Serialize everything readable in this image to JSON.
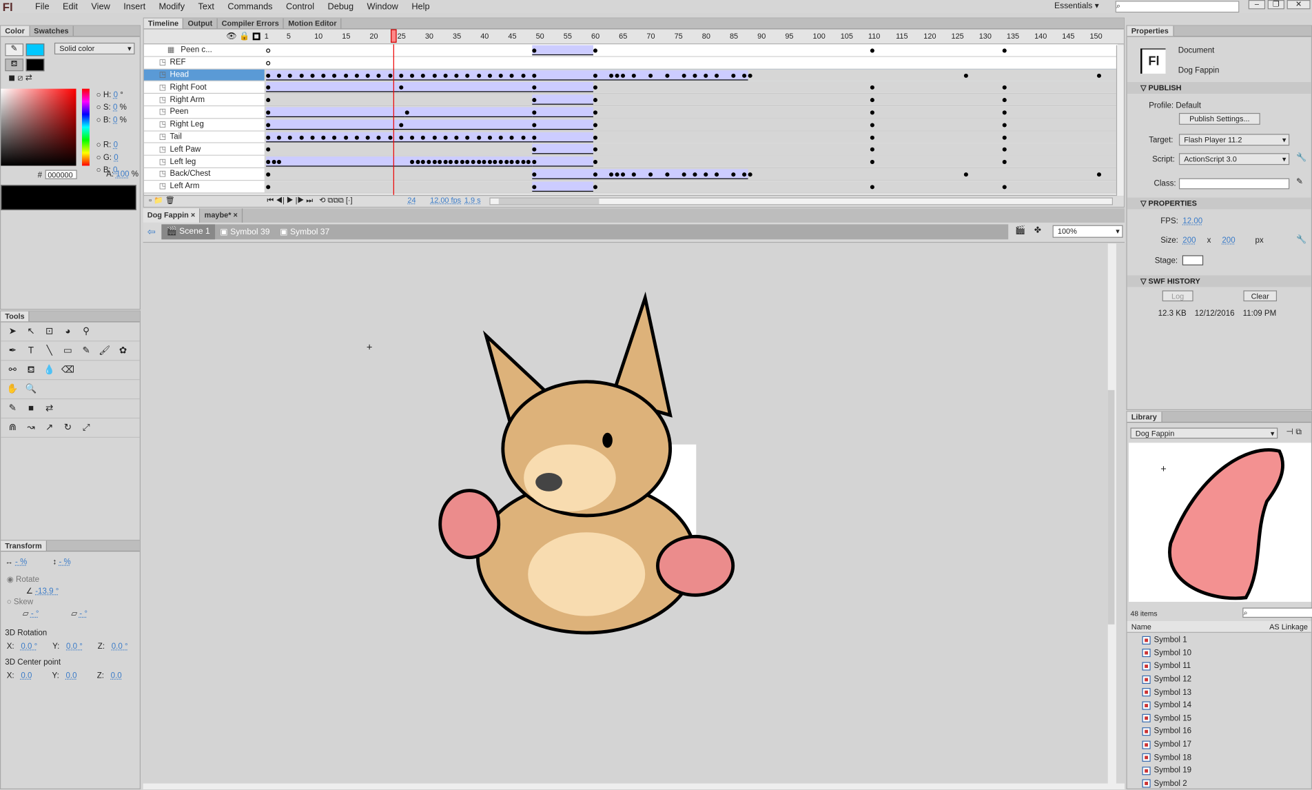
{
  "menu": {
    "logo": "Fl",
    "items": [
      "File",
      "Edit",
      "View",
      "Insert",
      "Modify",
      "Text",
      "Commands",
      "Control",
      "Debug",
      "Window",
      "Help"
    ],
    "workspace": "Essentials ▾"
  },
  "color_panel": {
    "tabs": [
      "Color",
      "Swatches"
    ],
    "type": "Solid color",
    "stroke_color": "#00c8ff",
    "fill_color": "#000000",
    "H": "0",
    "S": "0",
    "B": "0",
    "R": "0",
    "G": "0",
    "Bv": "0",
    "hex": "000000",
    "A": "100",
    "deg": "°",
    "pct": "%"
  },
  "tools": {
    "title": "Tools"
  },
  "transform": {
    "title": "Transform",
    "w": "- %",
    "h": "- %",
    "rotate_label": "Rotate",
    "rotate": "-13.9 °",
    "skew_label": "Skew",
    "skew1": "- °",
    "skew2": "- °",
    "rot3d": "3D Rotation",
    "center3d": "3D Center point",
    "x": "0.0 °",
    "y": "0.0 °",
    "z": "0.0 °",
    "cx": "0.0",
    "cy": "0.0",
    "cz": "0.0",
    "xl": "X:",
    "yl": "Y:",
    "zl": "Z:"
  },
  "timeline": {
    "tabs": [
      "Timeline",
      "Output",
      "Compiler Errors",
      "Motion Editor"
    ],
    "current_frame": 24,
    "fps": "12.00 fps",
    "time": "1.9 s",
    "frame_label": "24",
    "ticks": [
      1,
      5,
      10,
      15,
      20,
      25,
      30,
      35,
      40,
      45,
      50,
      55,
      60,
      65,
      70,
      75,
      80,
      85,
      90,
      95,
      100,
      105,
      110,
      115,
      120,
      125,
      130,
      135,
      140,
      145,
      150
    ],
    "layers": [
      {
        "name": "Peen c...",
        "color": "#55eeee",
        "locked": true,
        "keys": [
          49,
          60,
          110,
          134
        ],
        "empty": [
          1
        ],
        "tweens": [
          [
            49,
            60
          ]
        ],
        "white": true,
        "folder": true
      },
      {
        "name": "REF",
        "color": "#4f7fff",
        "keys": [],
        "empty": [
          1
        ],
        "tweens": [],
        "white": true
      },
      {
        "name": "Head",
        "color": "#ff8800",
        "selected": true,
        "keys": [
          1,
          3,
          5,
          7,
          9,
          11,
          13,
          15,
          17,
          19,
          21,
          23,
          25,
          27,
          29,
          31,
          33,
          35,
          37,
          39,
          41,
          43,
          45,
          47,
          49,
          60,
          63,
          64,
          65,
          67,
          70,
          73,
          76,
          78,
          80,
          82,
          85,
          87,
          88,
          127,
          151
        ],
        "tweens": [
          [
            1,
            49
          ],
          [
            49,
            60
          ],
          [
            60,
            88
          ]
        ]
      },
      {
        "name": "Right Foot",
        "color": "#777777",
        "keys": [
          1,
          25,
          49,
          60,
          110,
          134
        ],
        "tweens": [
          [
            1,
            25
          ],
          [
            25,
            49
          ],
          [
            49,
            60
          ]
        ]
      },
      {
        "name": "Right Arm",
        "color": "#4f7fff",
        "keys": [
          1,
          49,
          60,
          110,
          134
        ],
        "tweens": [
          [
            49,
            60
          ]
        ]
      },
      {
        "name": "Peen",
        "color": "#55eeee",
        "keys": [
          1,
          26,
          49,
          60,
          110,
          134
        ],
        "tweens": [
          [
            1,
            26
          ],
          [
            26,
            49
          ],
          [
            49,
            60
          ]
        ]
      },
      {
        "name": "Right Leg",
        "color": "#ff8800",
        "keys": [
          1,
          25,
          49,
          60,
          110,
          134
        ],
        "tweens": [
          [
            1,
            25
          ],
          [
            25,
            49
          ],
          [
            49,
            60
          ]
        ]
      },
      {
        "name": "Tail",
        "color": "#44ee44",
        "keys": [
          1,
          3,
          5,
          7,
          9,
          11,
          13,
          15,
          17,
          19,
          21,
          23,
          25,
          27,
          29,
          31,
          33,
          35,
          37,
          39,
          41,
          43,
          45,
          47,
          49,
          60,
          110,
          134
        ],
        "tweens": [
          [
            1,
            49
          ],
          [
            49,
            60
          ]
        ]
      },
      {
        "name": "Left Paw",
        "color": "#44ee44",
        "keys": [
          1,
          49,
          60,
          110,
          134
        ],
        "tweens": [
          [
            49,
            60
          ]
        ]
      },
      {
        "name": "Left leg",
        "color": "#9933cc",
        "keys": [
          1,
          2,
          3,
          27,
          28,
          29,
          30,
          31,
          32,
          33,
          34,
          35,
          36,
          37,
          38,
          39,
          40,
          41,
          42,
          43,
          44,
          45,
          46,
          47,
          48,
          49,
          60,
          110,
          134
        ],
        "tweens": [
          [
            1,
            49
          ],
          [
            49,
            60
          ]
        ]
      },
      {
        "name": "Back/Chest",
        "color": "#9933cc",
        "keys": [
          1,
          49,
          60,
          63,
          64,
          65,
          67,
          70,
          73,
          76,
          78,
          80,
          82,
          85,
          87,
          88,
          127,
          151
        ],
        "tweens": [
          [
            49,
            60
          ],
          [
            60,
            88
          ]
        ]
      },
      {
        "name": "Left Arm",
        "color": "#ff44ff",
        "locked": true,
        "keys": [
          1,
          49,
          60,
          110,
          134
        ],
        "tweens": [
          [
            49,
            60
          ]
        ]
      }
    ]
  },
  "doc_tabs": [
    "Dog Fappin",
    "maybe*"
  ],
  "breadcrumb": [
    "Scene 1",
    "Symbol 39",
    "Symbol 37"
  ],
  "zoom": "100%",
  "properties": {
    "tab": "Properties",
    "type": "Document",
    "name": "Dog Fappin",
    "publish": "PUBLISH",
    "profile_label": "Profile:",
    "profile": "Default",
    "publish_settings": "Publish Settings...",
    "target_label": "Target:",
    "target": "Flash Player 11.2",
    "script_label": "Script:",
    "script": "ActionScript 3.0",
    "class_label": "Class:",
    "props": "PROPERTIES",
    "fps_label": "FPS:",
    "fps": "12.00",
    "size_label": "Size:",
    "w": "200",
    "x": "x",
    "h": "200",
    "px": "px",
    "stage_label": "Stage:",
    "stage_color": "#ffffff",
    "swf": "SWF HISTORY",
    "log": "Log",
    "clear": "Clear",
    "size": "12.3 KB",
    "date": "12/12/2016",
    "time": "11:09 PM"
  },
  "library": {
    "tab": "Library",
    "doc": "Dog Fappin",
    "count": "48 items",
    "col_name": "Name",
    "col_link": "AS Linkage",
    "items": [
      "Symbol 1",
      "Symbol 10",
      "Symbol 11",
      "Symbol 12",
      "Symbol 13",
      "Symbol 14",
      "Symbol 15",
      "Symbol 16",
      "Symbol 17",
      "Symbol 18",
      "Symbol 19",
      "Symbol 2"
    ]
  }
}
